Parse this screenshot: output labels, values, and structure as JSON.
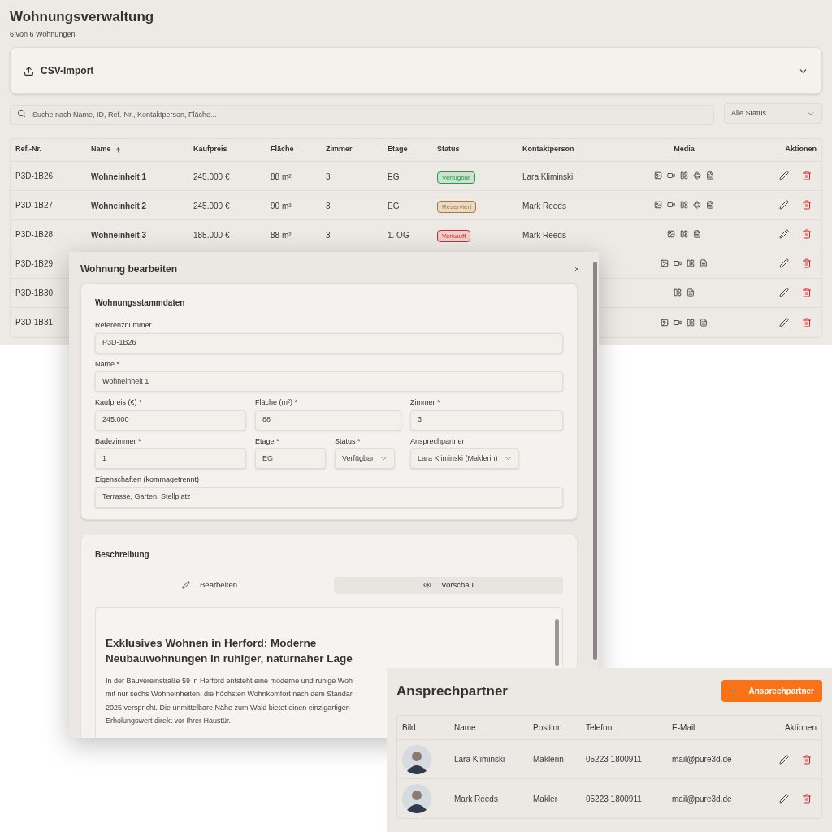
{
  "page": {
    "title": "Wohnungsverwaltung",
    "subtitle": "6 von 6 Wohnungen"
  },
  "csv_import": {
    "label": "CSV-Import",
    "expanded": false
  },
  "search": {
    "placeholder": "Suche nach Name, ID, Ref.-Nr., Kontaktperson, Fläche..."
  },
  "status_filter": {
    "value": "Alle Status"
  },
  "table": {
    "columns": [
      {
        "label": "Ref.-Nr.",
        "sorted": false
      },
      {
        "label": "Name",
        "sorted": true
      },
      {
        "label": "Kaufpreis",
        "sorted": false
      },
      {
        "label": "Fläche",
        "sorted": false
      },
      {
        "label": "Zimmer",
        "sorted": false
      },
      {
        "label": "Etage",
        "sorted": false
      },
      {
        "label": "Status",
        "sorted": false
      },
      {
        "label": "Kontaktperson",
        "sorted": false
      },
      {
        "label": "Media",
        "sorted": false
      },
      {
        "label": "Aktionen",
        "sorted": false
      }
    ],
    "rows": [
      {
        "ref": "P3D-1B26",
        "name": "Wohneinheit 1",
        "price": "245.000 €",
        "area": "88 m²",
        "rooms": "3",
        "floor": "EG",
        "status": {
          "label": "Verfügbar",
          "color": "#16a34a"
        },
        "contact": "Lara Kliminski",
        "media": [
          {
            "kind": "image"
          },
          {
            "kind": "video"
          },
          {
            "kind": "plan"
          },
          {
            "kind": "tour"
          },
          {
            "kind": "doc"
          }
        ]
      },
      {
        "ref": "P3D-1B27",
        "name": "Wohneinheit 2",
        "price": "245.000 €",
        "area": "90 m²",
        "rooms": "3",
        "floor": "EG",
        "status": {
          "label": "Reserviert",
          "color": "#b7791f"
        },
        "contact": "Mark Reeds",
        "media": [
          {
            "kind": "image"
          },
          {
            "kind": "video"
          },
          {
            "kind": "plan"
          },
          {
            "kind": "tour"
          },
          {
            "kind": "doc"
          }
        ]
      },
      {
        "ref": "P3D-1B28",
        "name": "Wohneinheit 3",
        "price": "185.000 €",
        "area": "88 m²",
        "rooms": "3",
        "floor": "1. OG",
        "status": {
          "label": "Verkauft",
          "color": "#dc2626"
        },
        "contact": "Mark Reeds",
        "media": [
          {
            "kind": "image"
          },
          {
            "kind": "plan"
          },
          {
            "kind": "doc"
          }
        ]
      },
      {
        "ref": "P3D-1B29",
        "media": [
          {
            "kind": "image"
          },
          {
            "kind": "video"
          },
          {
            "kind": "plan"
          },
          {
            "kind": "doc"
          }
        ]
      },
      {
        "ref": "P3D-1B30",
        "media": [
          {
            "kind": "plan"
          },
          {
            "kind": "doc"
          }
        ]
      },
      {
        "ref": "P3D-1B31",
        "media": [
          {
            "kind": "image"
          },
          {
            "kind": "video"
          },
          {
            "kind": "plan"
          },
          {
            "kind": "doc"
          }
        ]
      }
    ]
  },
  "edit_dialog": {
    "title": "Wohnung bearbeiten",
    "master_data": {
      "title": "Wohnungsstammdaten",
      "fields": [
        {
          "label": "Referenznummer",
          "value": "P3D-1B26",
          "kind": "text"
        },
        {
          "label": "Name *",
          "value": "Wohneinheit 1",
          "kind": "text"
        },
        {
          "label": "Kaufpreis (€) *",
          "value": "245.000",
          "kind": "text"
        },
        {
          "label": "Fläche (m²) *",
          "value": "88",
          "kind": "text"
        },
        {
          "label": "Zimmer *",
          "value": "3",
          "kind": "text"
        },
        {
          "label": "Badezimmer *",
          "value": "1",
          "kind": "text"
        },
        {
          "label": "Etage *",
          "value": "EG",
          "kind": "text"
        },
        {
          "label": "Status *",
          "value": "Verfügbar",
          "kind": "select"
        },
        {
          "label": "Ansprechpartner",
          "value": "Lara Kliminski (Maklerin)",
          "kind": "select"
        },
        {
          "label": "Eigenschaften (kommagetrennt)",
          "value": "Terrasse, Garten, Stellplatz",
          "kind": "text"
        }
      ]
    },
    "description": {
      "title": "Beschreibung",
      "tabs": [
        {
          "label": "Bearbeiten",
          "selected": false
        },
        {
          "label": "Vorschau",
          "selected": true
        }
      ],
      "preview": {
        "heading": "Exklusives Wohnen in Herford: Moderne Neubauwohnungen in ruhiger, naturnaher Lage",
        "lines": [
          "In der Bauvereinstraße 59 in Herford entsteht eine moderne und ruhige Woh",
          "mit nur sechs Wohneinheiten, die höchsten Wohnkomfort nach dem Standar",
          "2025 verspricht. Die unmittelbare Nähe zum Wald bietet einen einzigartigen",
          "Erholungswert direkt vor Ihrer Haustür."
        ]
      }
    }
  },
  "contacts": {
    "title": "Ansprechpartner",
    "add_button": "Ansprechpartner",
    "columns": [
      "Bild",
      "Name",
      "Position",
      "Telefon",
      "E-Mail",
      "Aktionen"
    ],
    "rows": [
      {
        "name": "Lara Kliminski",
        "position": "Maklerin",
        "phone": "05223 1800911",
        "email": "mail@pure3d.de"
      },
      {
        "name": "Mark Reeds",
        "position": "Makler",
        "phone": "05223 1800911",
        "email": "mail@pure3d.de"
      }
    ]
  }
}
